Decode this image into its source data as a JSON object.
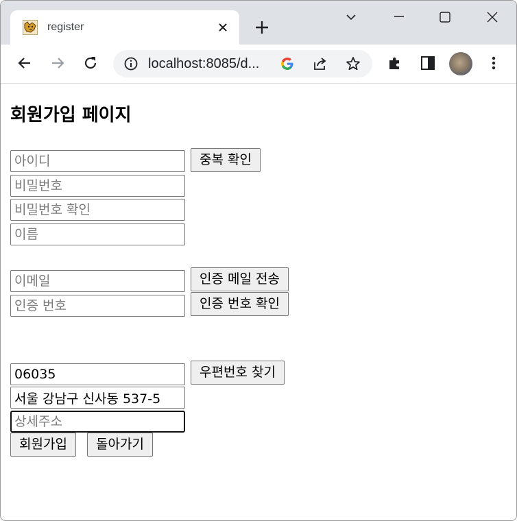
{
  "browser": {
    "tab_title": "register",
    "url": "localhost:8085/d..."
  },
  "page": {
    "title": "회원가입 페이지",
    "id_placeholder": "아이디",
    "check_duplicate_label": "중복 확인",
    "password_placeholder": "비밀번호",
    "password_confirm_placeholder": "비밀번호 확인",
    "name_placeholder": "이름",
    "email_placeholder": "이메일",
    "send_verify_mail_label": "인증 메일 전송",
    "verify_code_placeholder": "인증 번호",
    "confirm_verify_code_label": "인증 번호 확인",
    "postcode_value": "06035",
    "find_postcode_label": "우편번호 찾기",
    "address_value": "서울 강남구 신사동 537-5",
    "detail_address_placeholder": "상세주소",
    "register_button_label": "회원가입",
    "back_button_label": "돌아가기"
  }
}
